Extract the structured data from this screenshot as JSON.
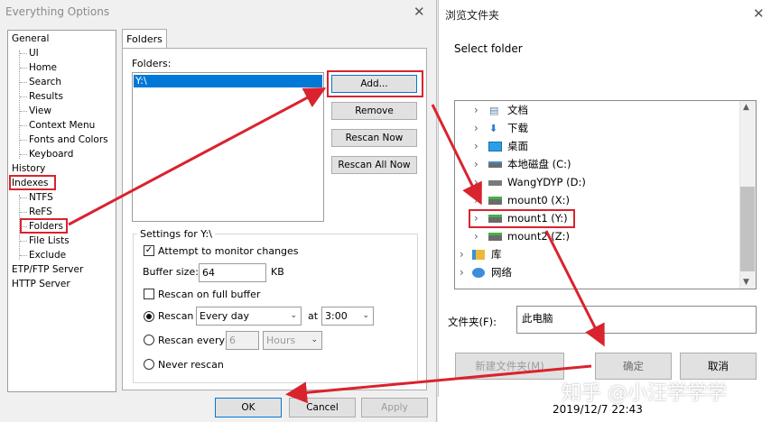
{
  "options_window": {
    "title": "Everything Options",
    "tree": [
      {
        "label": "General"
      },
      {
        "label": "UI"
      },
      {
        "label": "Home"
      },
      {
        "label": "Search"
      },
      {
        "label": "Results"
      },
      {
        "label": "View"
      },
      {
        "label": "Context Menu"
      },
      {
        "label": "Fonts and Colors"
      },
      {
        "label": "Keyboard"
      },
      {
        "label": "History"
      },
      {
        "label": "Indexes"
      },
      {
        "label": "NTFS"
      },
      {
        "label": "ReFS"
      },
      {
        "label": "Folders"
      },
      {
        "label": "File Lists"
      },
      {
        "label": "Exclude"
      },
      {
        "label": "ETP/FTP Server"
      },
      {
        "label": "HTTP Server"
      }
    ],
    "tab": "Folders",
    "folders_label": "Folders:",
    "folders": [
      "Y:\\"
    ],
    "buttons": {
      "add": "Add...",
      "remove": "Remove",
      "rescan_now": "Rescan Now",
      "rescan_all_now": "Rescan All Now"
    },
    "settings": {
      "group_label": "Settings for Y:\\",
      "monitor_label": "Attempt to monitor changes",
      "buffer_label": "Buffer size:",
      "buffer_value": "64",
      "buffer_unit": "KB",
      "rescan_full_label": "Rescan on full buffer",
      "rescan_label": "Rescan",
      "rescan_frequency": "Every day",
      "at_label": "at",
      "rescan_time": "3:00",
      "rescan_every_label": "Rescan every",
      "rescan_every_value": "6",
      "rescan_every_unit": "Hours",
      "never_label": "Never rescan"
    },
    "footer": {
      "ok": "OK",
      "cancel": "Cancel",
      "apply": "Apply"
    }
  },
  "browse_dialog": {
    "title": "浏览文件夹",
    "prompt": "Select folder",
    "items": [
      {
        "label": "文档",
        "icon": "document-icon"
      },
      {
        "label": "下载",
        "icon": "download-icon"
      },
      {
        "label": "桌面",
        "icon": "desktop-icon"
      },
      {
        "label": "本地磁盘 (C:)",
        "icon": "local-disk-icon"
      },
      {
        "label": "WangYDYP (D:)",
        "icon": "drive-icon"
      },
      {
        "label": "mount0 (X:)",
        "icon": "network-drive-icon"
      },
      {
        "label": "mount1 (Y:)",
        "icon": "network-drive-icon"
      },
      {
        "label": "mount2 (Z:)",
        "icon": "network-drive-icon"
      },
      {
        "label": "库",
        "icon": "library-icon"
      },
      {
        "label": "网络",
        "icon": "network-icon"
      }
    ],
    "folder_label": "文件夹(F):",
    "folder_value": "此电脑",
    "buttons": {
      "new_folder": "新建文件夹(M)",
      "ok": "确定",
      "cancel": "取消"
    }
  },
  "taskbar": {
    "datetime": "2019/12/7 22:43"
  },
  "watermark": "知乎 @小汪学学学",
  "colors": {
    "annotation_red": "#d9232e",
    "selection_blue": "#0078d7"
  }
}
